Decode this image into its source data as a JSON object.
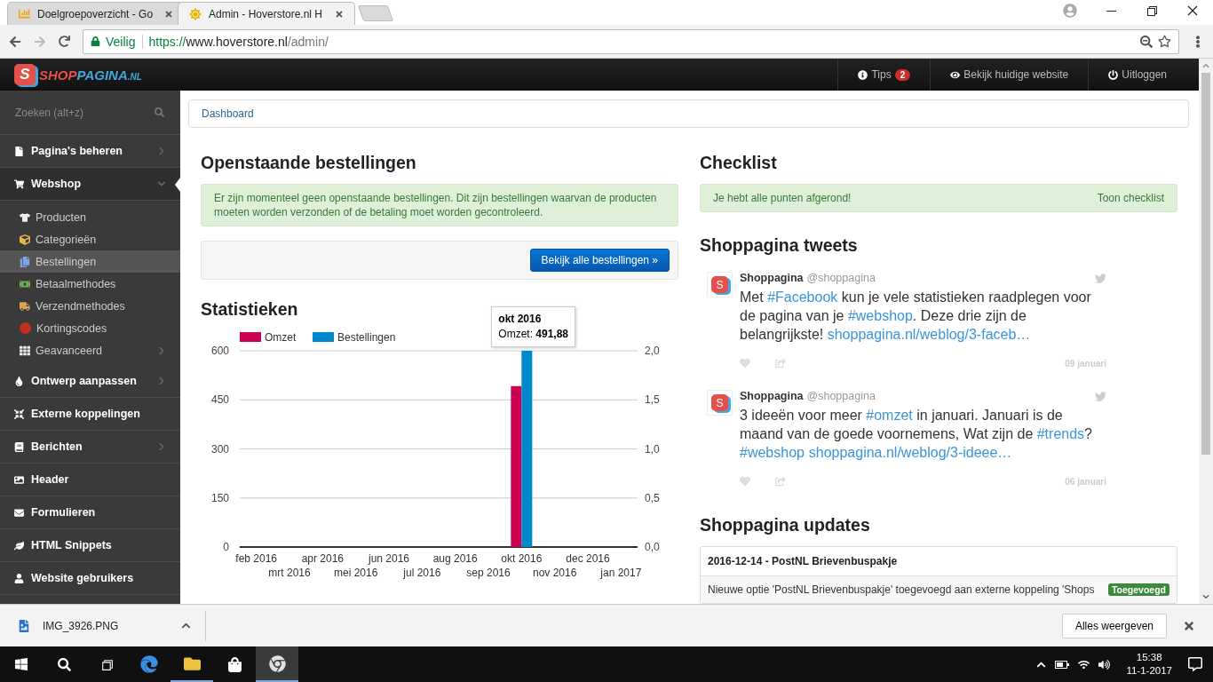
{
  "browser": {
    "tabs": [
      {
        "title": "Doelgroepoverzicht - Go",
        "selected": false
      },
      {
        "title": "Admin - Hoverstore.nl H",
        "selected": true
      }
    ],
    "security": "Veilig",
    "url_scheme": "https://",
    "url_host": "www.hoverstore.nl",
    "url_path": "/admin/"
  },
  "logo": {
    "mark": "S",
    "part_1": "SHOP",
    "part_2": "PAGINA",
    "suffix": ".NL"
  },
  "top_nav": [
    {
      "label": "Tips",
      "badge": "2"
    },
    {
      "label": "Bekijk huidige website"
    },
    {
      "label": "Uitloggen"
    }
  ],
  "sidebar": {
    "search": {
      "placeholder": "Zoeken (alt+z)"
    },
    "items": [
      {
        "label": "Pagina's beheren",
        "selected": false,
        "expanded": false
      },
      {
        "label": "Webshop",
        "selected": true,
        "expanded": true,
        "children": [
          {
            "label": "Producten",
            "selected": false
          },
          {
            "label": "Categorieën",
            "selected": false
          },
          {
            "label": "Bestellingen",
            "selected": true
          },
          {
            "label": "Betaalmethodes",
            "selected": false
          },
          {
            "label": "Verzendmethodes",
            "selected": false
          },
          {
            "label": "Kortingscodes",
            "selected": false
          },
          {
            "label": "Geavanceerd",
            "selected": false,
            "expanded": false
          }
        ]
      },
      {
        "label": "Ontwerp aanpassen",
        "selected": false,
        "expanded": false
      },
      {
        "label": "Externe koppelingen",
        "selected": false
      },
      {
        "label": "Berichten",
        "selected": false,
        "expanded": false
      },
      {
        "label": "Header",
        "selected": false
      },
      {
        "label": "Formulieren",
        "selected": false
      },
      {
        "label": "HTML Snippets",
        "selected": false
      },
      {
        "label": "Website gebruikers",
        "selected": false
      }
    ]
  },
  "breadcrumb": [
    "Dashboard"
  ],
  "orders": {
    "title": "Openstaande bestellingen",
    "notice": "Er zijn momenteel geen openstaande bestellingen. Dit zijn bestellingen waarvan de producten moeten worden verzonden of de betaling moet worden gecontroleerd.",
    "button": "Bekijk alle bestellingen »"
  },
  "statistics": {
    "title": "Statistieken",
    "tooltip": {
      "title": "okt 2016",
      "text": "Omzet: **491,88**"
    },
    "chart_data": {
      "type": "bar",
      "grid": true,
      "legend": "top-left",
      "categories": [
        "feb 2016",
        "mrt 2016",
        "apr 2016",
        "mei 2016",
        "jun 2016",
        "jul 2016",
        "aug 2016",
        "sep 2016",
        "okt 2016",
        "nov 2016",
        "dec 2016",
        "jan 2017"
      ],
      "series": [
        {
          "name": "Omzet",
          "color": "#cc0055",
          "values": [
            0,
            0,
            0,
            0,
            0,
            0,
            0,
            0,
            491.88,
            0,
            0,
            0
          ]
        },
        {
          "name": "Bestellingen",
          "color": "#0088cc",
          "axis": "y2",
          "values": [
            0,
            0,
            0,
            0,
            0,
            0,
            0,
            0,
            2,
            0,
            0,
            0
          ]
        }
      ],
      "ylim": [
        0,
        600
      ],
      "yticks": [
        0,
        150,
        300,
        450,
        600
      ],
      "y2lim": [
        0,
        2
      ],
      "y2ticks": [
        {
          "value": 0,
          "label": "0,0"
        },
        {
          "value": 0.5,
          "label": "0,5"
        },
        {
          "value": 1,
          "label": "1,0"
        },
        {
          "value": 1.5,
          "label": "1,5"
        },
        {
          "value": 2,
          "label": "2,0"
        }
      ]
    }
  },
  "checklist": {
    "title": "Checklist",
    "notice": "Je hebt alle punten afgerond!",
    "link": "Toon checklist"
  },
  "tweets": {
    "title": "Shoppagina tweets",
    "items": [
      {
        "avatar_mark": "S",
        "name": "Shoppagina",
        "handle": "@shoppagina",
        "date": "09 januari",
        "segments": [
          {
            "kind": "text",
            "text": "Met "
          },
          {
            "kind": "link",
            "text": "#Facebook"
          },
          {
            "kind": "text",
            "text": " kun je vele statistieken raadplegen voor de pagina van je "
          },
          {
            "kind": "link",
            "text": "#webshop"
          },
          {
            "kind": "text",
            "text": ". Deze drie zijn de belangrijkste! "
          },
          {
            "kind": "link",
            "text": "shoppagina.nl/weblog/3-faceb…"
          }
        ]
      },
      {
        "avatar_mark": "S",
        "name": "Shoppagina",
        "handle": "@shoppagina",
        "date": "06 januari",
        "segments": [
          {
            "kind": "text",
            "text": "3 ideeën voor meer "
          },
          {
            "kind": "link",
            "text": "#omzet"
          },
          {
            "kind": "text",
            "text": " in januari. Januari is de maand van de goede voornemens, Wat zijn de "
          },
          {
            "kind": "link",
            "text": "#trends"
          },
          {
            "kind": "text",
            "text": "? "
          },
          {
            "kind": "link",
            "text": "#webshop"
          },
          {
            "kind": "link",
            "text": "shoppagina.nl/weblog/3-ideee…"
          }
        ]
      }
    ]
  },
  "updates": {
    "title": "Shoppagina updates",
    "items": [
      {
        "title": "2016-12-14 - PostNL Brievenbuspakje",
        "text": "Nieuwe optie 'PostNL Brievenbuspakje' toegevoegd aan externe koppeling 'Shops",
        "badge": "Toegevoegd"
      }
    ]
  },
  "download_bar": {
    "file": "IMG_3926.PNG",
    "button": "Alles weergeven"
  },
  "taskbar": {
    "time": "15:38",
    "date": "11-1-2017"
  }
}
